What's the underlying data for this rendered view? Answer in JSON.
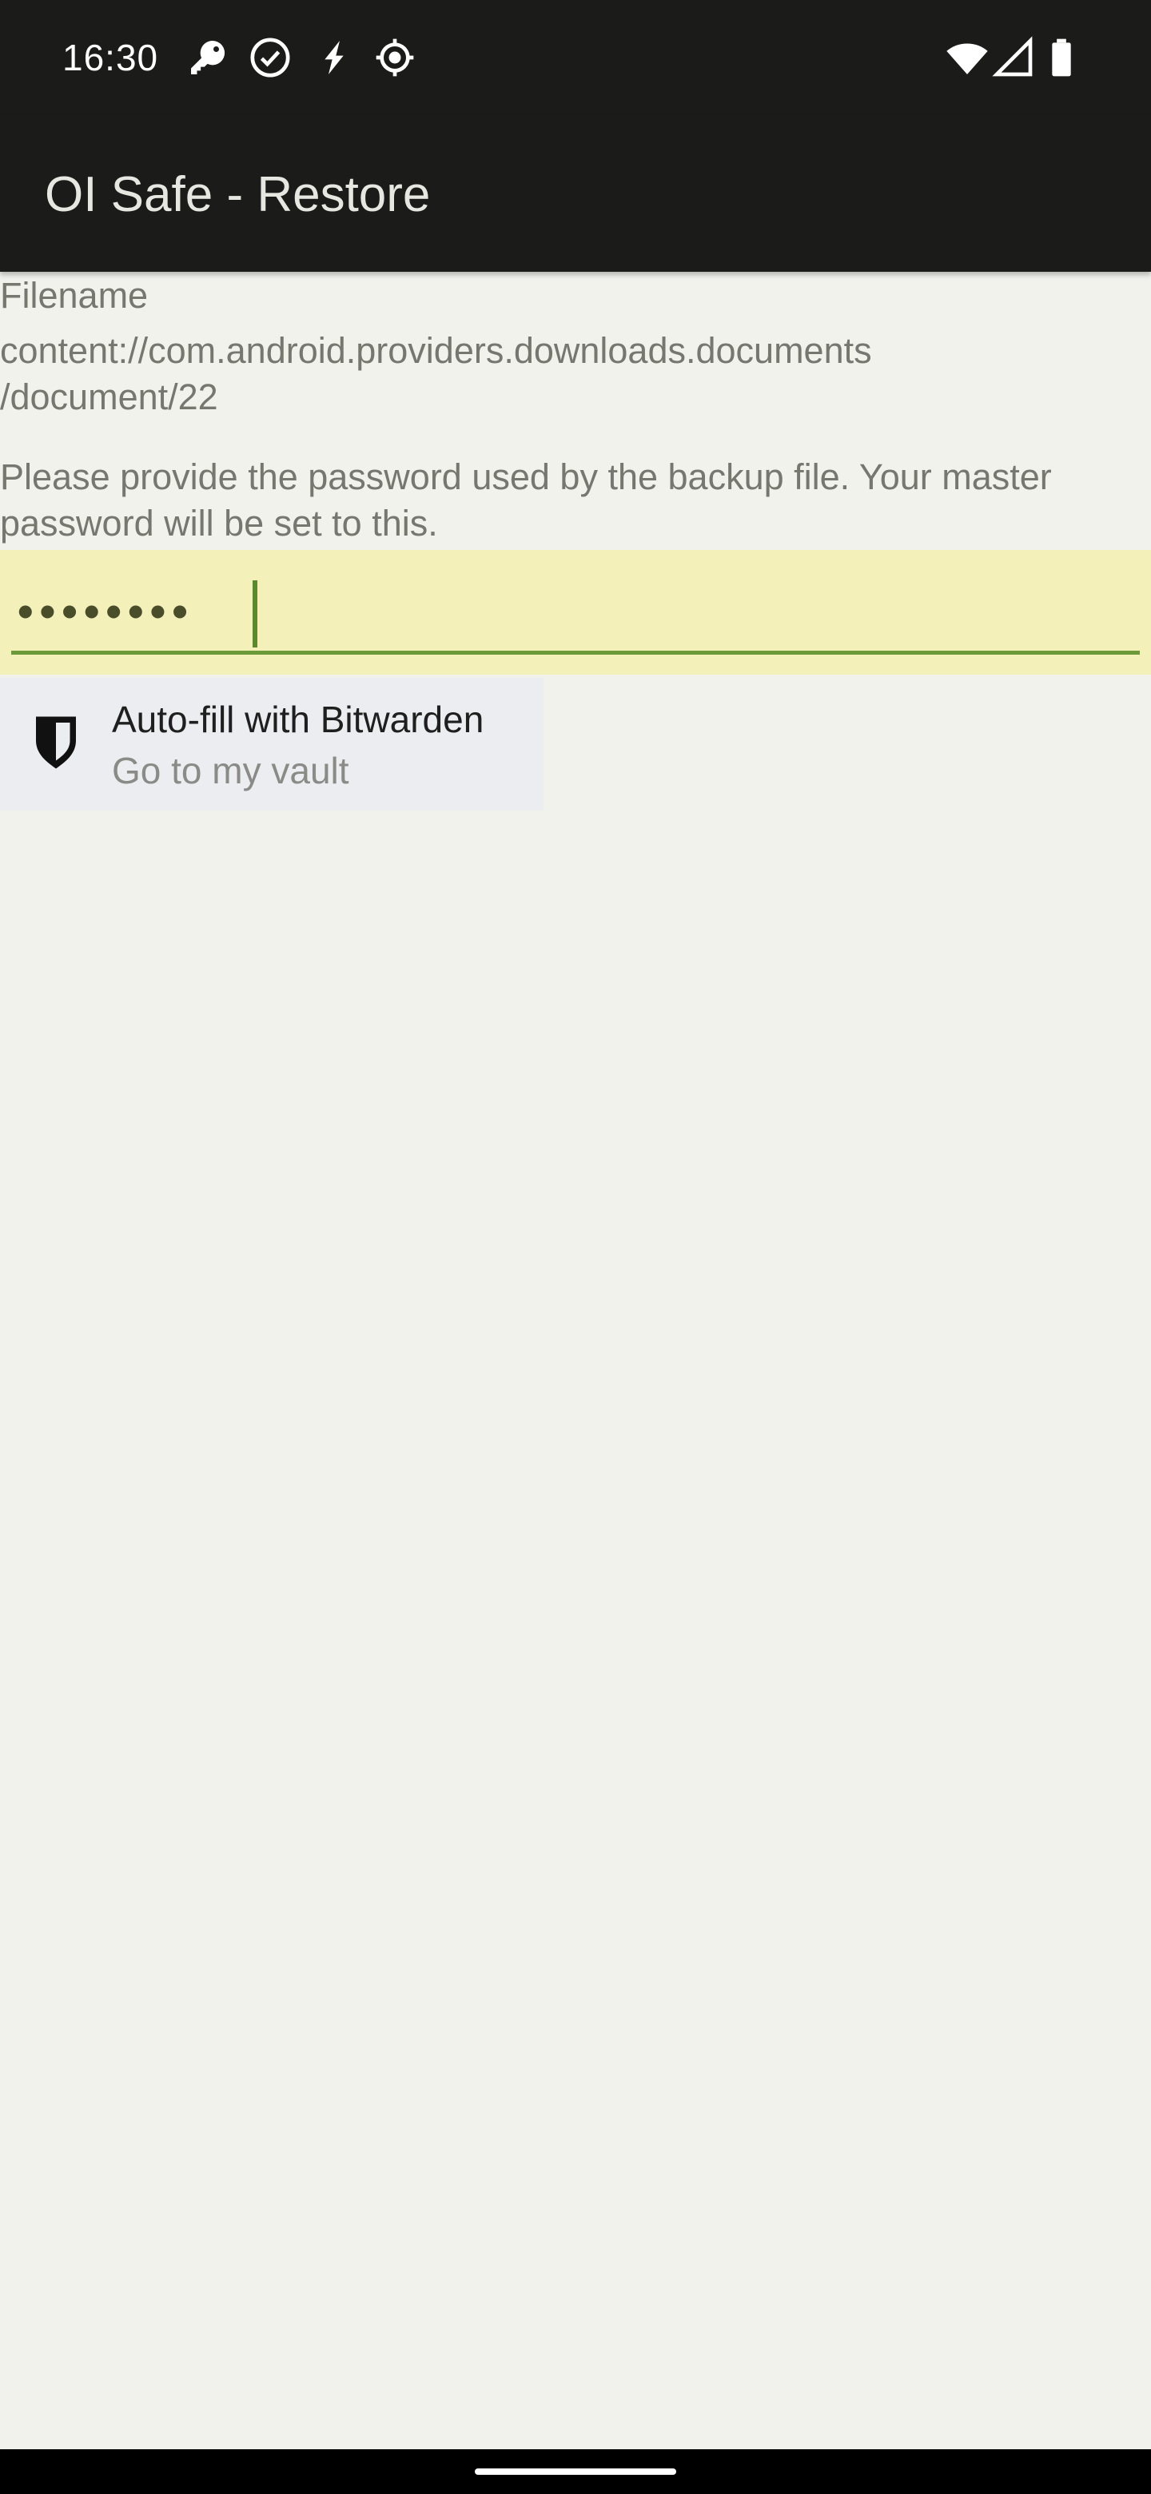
{
  "status_bar": {
    "time": "16:30",
    "icons_left": [
      "key-icon",
      "check-circle-icon",
      "bolt-icon",
      "location-icon"
    ],
    "icons_right": [
      "wifi-icon",
      "cell-signal-icon",
      "battery-icon"
    ]
  },
  "app_bar": {
    "title": "OI Safe - Restore"
  },
  "content": {
    "filename_label": "Filename",
    "filename_value": "content://com.android.providers.downloads.documents\n/document/22",
    "instruction": "Please provide the password used by the backup file. Your master password will be set to this."
  },
  "password_field": {
    "masked_value": "••••••••",
    "background_color": "#f4f0ba",
    "accent_color": "#6a9a3a"
  },
  "autofill": {
    "title": "Auto-fill with Bitwarden",
    "subtitle": "Go to my vault",
    "icon": "bitwarden-shield-icon"
  },
  "colors": {
    "bar_background": "#1b1c1a",
    "page_background": "#f2f2ed",
    "secondary_text": "#76776f"
  }
}
